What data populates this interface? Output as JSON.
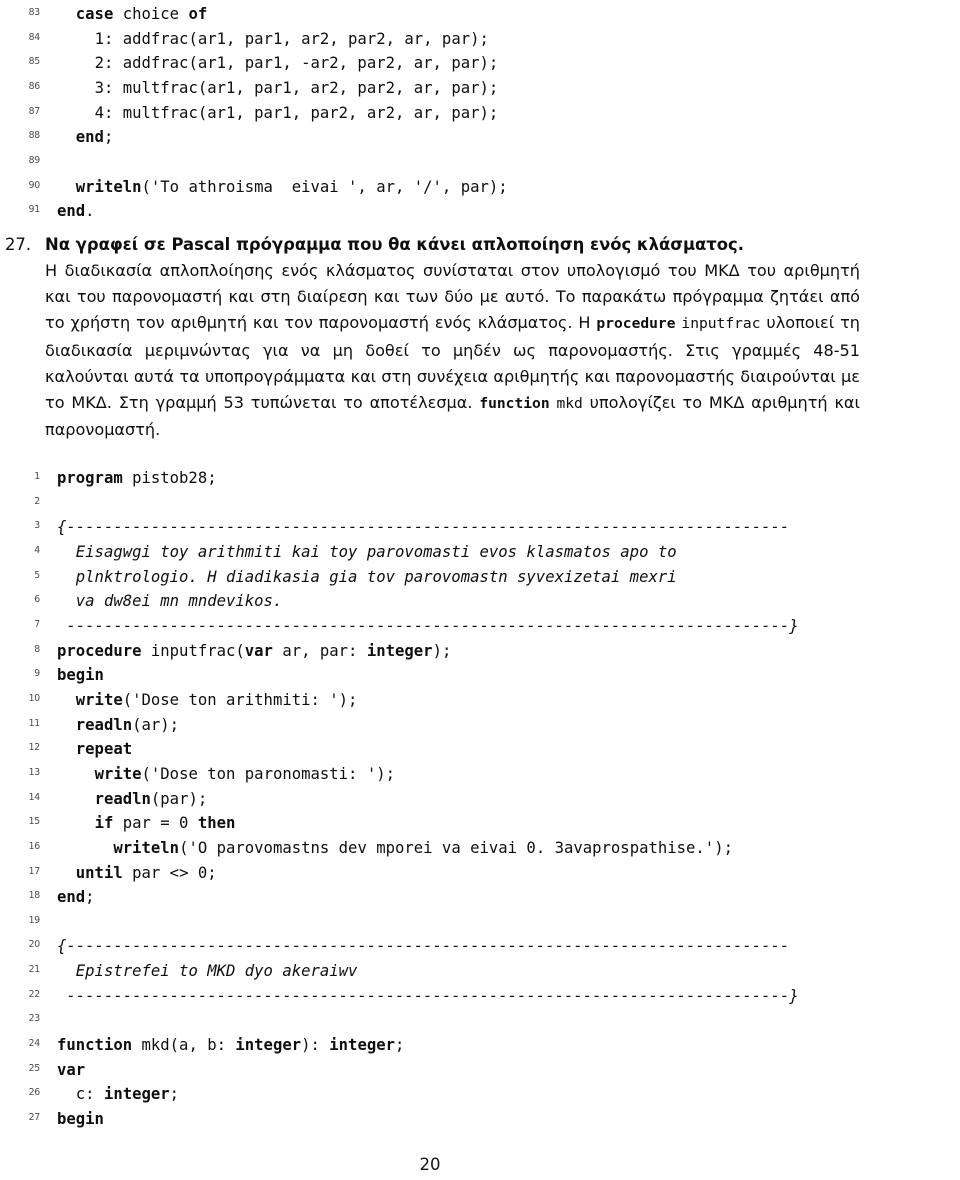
{
  "page": {
    "number": "20"
  },
  "listing_top": {
    "lines": [
      {
        "no": "83",
        "indent": 1,
        "segments": [
          {
            "t": "case",
            "s": "kw"
          },
          {
            "t": " choice ",
            "s": ""
          },
          {
            "t": "of",
            "s": "kw"
          }
        ]
      },
      {
        "no": "84",
        "indent": 2,
        "segments": [
          {
            "t": "1: addfrac(ar1, par1, ar2, par2, ar, par);",
            "s": ""
          }
        ]
      },
      {
        "no": "85",
        "indent": 2,
        "segments": [
          {
            "t": "2: addfrac(ar1, par1, -ar2, par2, ar, par);",
            "s": ""
          }
        ]
      },
      {
        "no": "86",
        "indent": 2,
        "segments": [
          {
            "t": "3: multfrac(ar1, par1, ar2, par2, ar, par);",
            "s": ""
          }
        ]
      },
      {
        "no": "87",
        "indent": 2,
        "segments": [
          {
            "t": "4: multfrac(ar1, par1, par2, ar2, ar, par);",
            "s": ""
          }
        ]
      },
      {
        "no": "88",
        "indent": 1,
        "segments": [
          {
            "t": "end",
            "s": "kw"
          },
          {
            "t": ";",
            "s": ""
          }
        ]
      },
      {
        "no": "89",
        "indent": 0,
        "segments": []
      },
      {
        "no": "90",
        "indent": 1,
        "segments": [
          {
            "t": "writeln",
            "s": "kw"
          },
          {
            "t": "('To athroisma  eivai ', ar, '/', par);",
            "s": ""
          }
        ]
      },
      {
        "no": "91",
        "indent": 0,
        "segments": [
          {
            "t": "end",
            "s": "kw"
          },
          {
            "t": ".",
            "s": ""
          }
        ]
      }
    ]
  },
  "exercise": {
    "number": "27.",
    "heading": "Να γραφεί σε Pascal πρόγραμμα που θα κάνει απλοποίηση ενός κλάσματος.",
    "body": [
      {
        "t": "Η διαδικασία απλοπλοίησης ενός κλάσματος συνίσταται στον υπολογισμό του ΜΚΔ του αριθμητή και του παρονομαστή και στη διαίρεση και των δύο με αυτό. Το παρακάτω πρόγραμμα ζητάει από το χρήστη τον αριθμητή και τον παρονομαστή ενός κλάσματος. Η ",
        "s": ""
      },
      {
        "t": "procedure",
        "s": "mono b"
      },
      {
        "t": " ",
        "s": ""
      },
      {
        "t": "inputfrac",
        "s": "mono"
      },
      {
        "t": " υλοποιεί τη διαδικασία μεριμνώντας για να μη δοθεί το μηδέν ως παρονομαστής. Στις γραμμές 48-51 καλούνται αυτά τα υποπρογράμματα και στη συνέχεια αριθμητής και παρονομαστής διαιρούνται με το ΜΚΔ. Στη γραμμή 53 τυπώνεται το αποτέλεσμα. ",
        "s": ""
      },
      {
        "t": "function",
        "s": "mono b"
      },
      {
        "t": " ",
        "s": ""
      },
      {
        "t": "mkd",
        "s": "mono"
      },
      {
        "t": " υπολογίζει το ΜΚΔ αριθμητή και παρονομαστή.",
        "s": ""
      }
    ]
  },
  "listing_main": {
    "lines": [
      {
        "no": "1",
        "indent": 0,
        "segments": [
          {
            "t": "program",
            "s": "kw"
          },
          {
            "t": " pistob28;",
            "s": ""
          }
        ]
      },
      {
        "no": "2",
        "indent": 0,
        "segments": []
      },
      {
        "no": "3",
        "indent": 0,
        "segments": [
          {
            "t": "{-----------------------------------------------------------------------------",
            "s": "cm"
          }
        ]
      },
      {
        "no": "4",
        "indent": 1,
        "segments": [
          {
            "t": "Eisagwgi toy arithmiti kai toy parovomasti evos klasmatos apo to",
            "s": "cm"
          }
        ]
      },
      {
        "no": "5",
        "indent": 1,
        "segments": [
          {
            "t": "plnktrologio. H diadikasia gia tov parovomastn syvexizetai mexri",
            "s": "cm"
          }
        ]
      },
      {
        "no": "6",
        "indent": 1,
        "segments": [
          {
            "t": "va dw8ei mn mndevikos.",
            "s": "cm"
          }
        ]
      },
      {
        "no": "7",
        "indent": 0,
        "segments": [
          {
            "t": " -----------------------------------------------------------------------------}",
            "s": "cm"
          }
        ]
      },
      {
        "no": "8",
        "indent": 0,
        "segments": [
          {
            "t": "procedure",
            "s": "kw"
          },
          {
            "t": " inputfrac(",
            "s": ""
          },
          {
            "t": "var",
            "s": "kw"
          },
          {
            "t": " ar, par: ",
            "s": ""
          },
          {
            "t": "integer",
            "s": "kw"
          },
          {
            "t": ");",
            "s": ""
          }
        ]
      },
      {
        "no": "9",
        "indent": 0,
        "segments": [
          {
            "t": "begin",
            "s": "kw"
          }
        ]
      },
      {
        "no": "10",
        "indent": 1,
        "segments": [
          {
            "t": "write",
            "s": "kw"
          },
          {
            "t": "('Dose ton arithmiti: ');",
            "s": ""
          }
        ]
      },
      {
        "no": "11",
        "indent": 1,
        "segments": [
          {
            "t": "readln",
            "s": "kw"
          },
          {
            "t": "(ar);",
            "s": ""
          }
        ]
      },
      {
        "no": "12",
        "indent": 1,
        "segments": [
          {
            "t": "repeat",
            "s": "kw"
          }
        ]
      },
      {
        "no": "13",
        "indent": 2,
        "segments": [
          {
            "t": "write",
            "s": "kw"
          },
          {
            "t": "('Dose ton paronomasti: ');",
            "s": ""
          }
        ]
      },
      {
        "no": "14",
        "indent": 2,
        "segments": [
          {
            "t": "readln",
            "s": "kw"
          },
          {
            "t": "(par);",
            "s": ""
          }
        ]
      },
      {
        "no": "15",
        "indent": 2,
        "segments": [
          {
            "t": "if",
            "s": "kw"
          },
          {
            "t": " par = 0 ",
            "s": ""
          },
          {
            "t": "then",
            "s": "kw"
          }
        ]
      },
      {
        "no": "16",
        "indent": 3,
        "segments": [
          {
            "t": "writeln",
            "s": "kw"
          },
          {
            "t": "('O parovomastns dev mporei va eivai 0. 3avaprospathise.');",
            "s": ""
          }
        ]
      },
      {
        "no": "17",
        "indent": 1,
        "segments": [
          {
            "t": "until",
            "s": "kw"
          },
          {
            "t": " par <> 0;",
            "s": ""
          }
        ]
      },
      {
        "no": "18",
        "indent": 0,
        "segments": [
          {
            "t": "end",
            "s": "kw"
          },
          {
            "t": ";",
            "s": ""
          }
        ]
      },
      {
        "no": "19",
        "indent": 0,
        "segments": []
      },
      {
        "no": "20",
        "indent": 0,
        "segments": [
          {
            "t": "{-----------------------------------------------------------------------------",
            "s": "cm"
          }
        ]
      },
      {
        "no": "21",
        "indent": 1,
        "segments": [
          {
            "t": "Epistrefei to MKD dyo akeraiwv",
            "s": "cm"
          }
        ]
      },
      {
        "no": "22",
        "indent": 0,
        "segments": [
          {
            "t": " -----------------------------------------------------------------------------}",
            "s": "cm"
          }
        ]
      },
      {
        "no": "23",
        "indent": 0,
        "segments": []
      },
      {
        "no": "24",
        "indent": 0,
        "segments": [
          {
            "t": "function",
            "s": "kw"
          },
          {
            "t": " mkd(a, b: ",
            "s": ""
          },
          {
            "t": "integer",
            "s": "kw"
          },
          {
            "t": "): ",
            "s": ""
          },
          {
            "t": "integer",
            "s": "kw"
          },
          {
            "t": ";",
            "s": ""
          }
        ]
      },
      {
        "no": "25",
        "indent": 0,
        "segments": [
          {
            "t": "var",
            "s": "kw"
          }
        ]
      },
      {
        "no": "26",
        "indent": 1,
        "segments": [
          {
            "t": "c: ",
            "s": ""
          },
          {
            "t": "integer",
            "s": "kw"
          },
          {
            "t": ";",
            "s": ""
          }
        ]
      },
      {
        "no": "27",
        "indent": 0,
        "segments": [
          {
            "t": "begin",
            "s": "kw"
          }
        ]
      }
    ]
  }
}
